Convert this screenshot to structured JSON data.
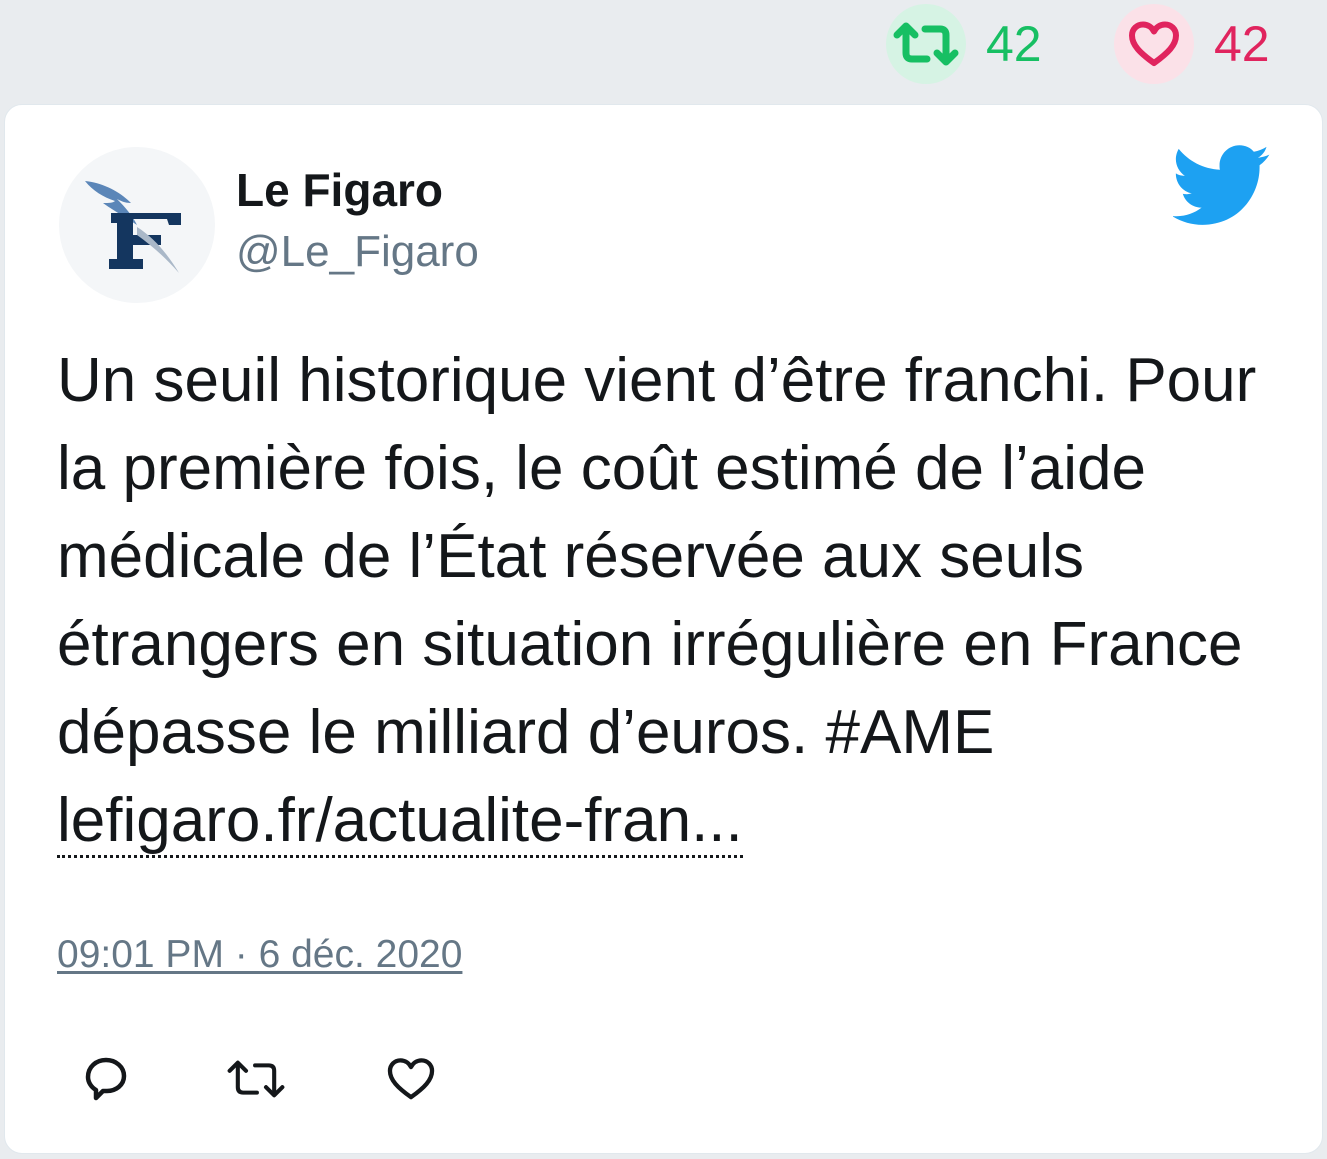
{
  "top_stats": {
    "retweet_count": "42",
    "like_count": "42",
    "retweet_icon": "retweet-icon",
    "like_icon": "heart-icon"
  },
  "tweet": {
    "author_name": "Le Figaro",
    "author_handle": "@Le_Figaro",
    "avatar_icon": "le-figaro-logo",
    "brand_icon": "twitter-bird-icon",
    "text": "Un seuil historique vient d’être franchi. Pour la première fois, le coût estimé de l’aide médicale de l’État réservée aux seuls étrangers en situation irrégulière en France dépasse le milliard d’euros. #AME",
    "link_text": "lefigaro.fr/actualite-fran...",
    "timestamp": "09:01 PM · 6 déc. 2020"
  },
  "actions": [
    "reply-icon",
    "retweet-icon",
    "heart-icon"
  ],
  "colors": {
    "background": "#e9ecef",
    "card": "#ffffff",
    "retweet_green": "#17bf63",
    "like_red": "#e0245e",
    "twitter_blue": "#1da1f2",
    "secondary_text": "#657786",
    "figaro_navy": "#14365f"
  }
}
